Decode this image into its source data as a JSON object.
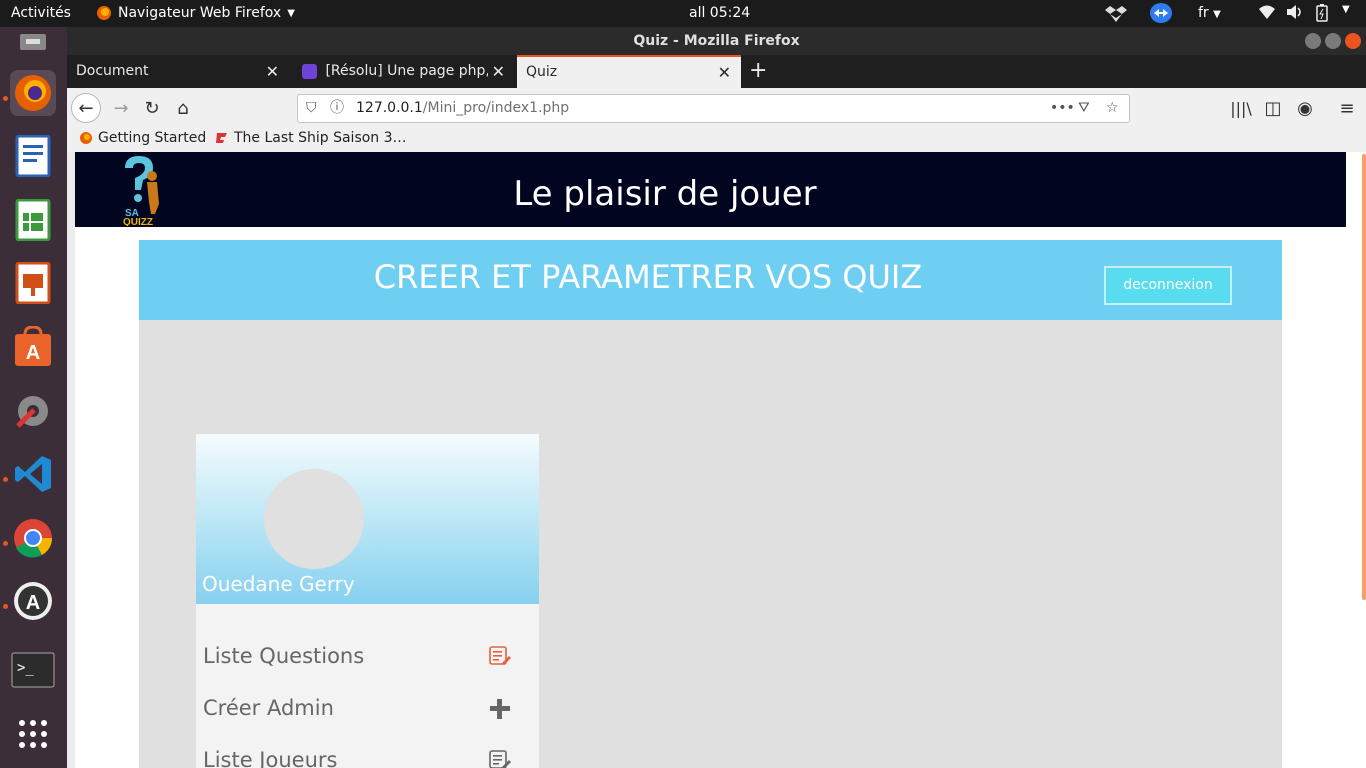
{
  "system": {
    "activities": "Activités",
    "app_menu": "Navigateur Web Firefox",
    "clock": "all 05:24",
    "lang": "fr"
  },
  "window": {
    "title": "Quiz - Mozilla Firefox"
  },
  "tabs": [
    {
      "label": "Document"
    },
    {
      "label": "[Résolu] Une page php, c"
    },
    {
      "label": "Quiz"
    }
  ],
  "url": {
    "host": "127.0.0.1",
    "path": "/Mini_pro/index1.php"
  },
  "bookmarks": [
    {
      "label": "Getting Started"
    },
    {
      "label": "The Last Ship Saison 3…"
    }
  ],
  "site": {
    "header_title": "Le plaisir de jouer",
    "logo_text_top": "SA",
    "logo_text_bottom": "QUIZZ",
    "panel_title": "CREER ET PARAMETRER VOS QUIZ",
    "logout_label": "deconnexion",
    "user_name": "Ouedane  Gerry",
    "menu": [
      {
        "label": "Liste Questions",
        "icon": "edit-list-icon"
      },
      {
        "label": "Créer Admin",
        "icon": "plus-icon"
      },
      {
        "label": "Liste Joueurs",
        "icon": "edit-list-icon"
      }
    ]
  },
  "colors": {
    "header_bg": "#01051f",
    "panel_head": "#6fcff3",
    "button": "#58dcf0",
    "accent": "#e95420"
  }
}
